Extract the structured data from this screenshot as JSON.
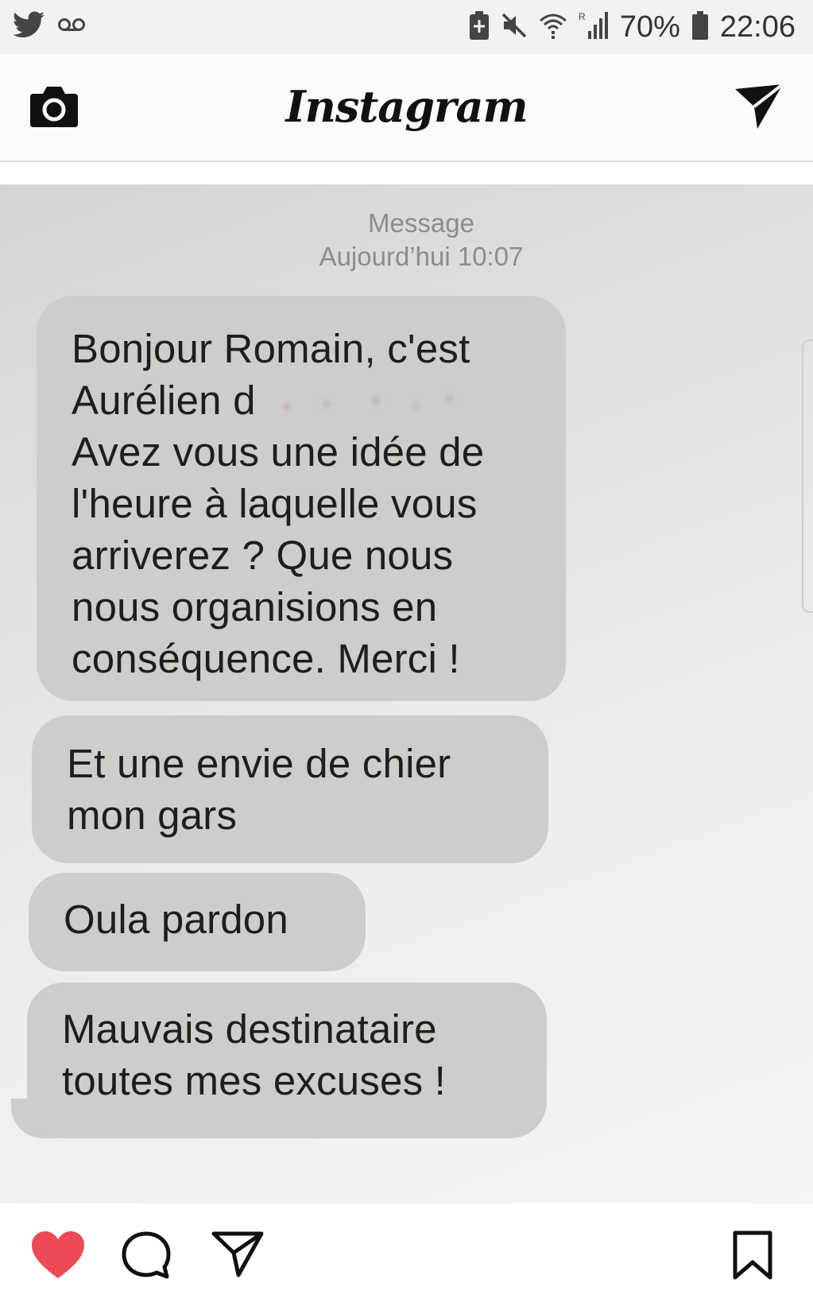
{
  "status_bar": {
    "battery_percent": "70%",
    "time": "22:06",
    "icons": [
      "twitter-icon",
      "voicemail-icon",
      "save-data-icon",
      "mute-icon",
      "wifi-icon",
      "signal-icon",
      "battery-icon"
    ]
  },
  "header": {
    "app_name": "Instagram",
    "icons": [
      "camera-icon",
      "direct-message-icon"
    ]
  },
  "post_image": {
    "meta_title": "Message",
    "meta_date": "Aujourd’hui 10:07",
    "bubbles": [
      {
        "lines": [
          "Bonjour Romain, c'est",
          "Aurélien d",
          "Avez vous une idée de",
          "l'heure à laquelle vous",
          "arriverez ? Que nous",
          "nous organisions en",
          "conséquence. Merci !"
        ]
      },
      {
        "lines": [
          "Et une envie de chier",
          "mon gars"
        ]
      },
      {
        "lines": [
          "Oula pardon"
        ]
      },
      {
        "lines": [
          "Mauvais destinataire",
          "toutes mes excuses !"
        ]
      }
    ]
  },
  "action_bar": {
    "liked": true,
    "like_color": "#ed4956",
    "icons": [
      "heart-icon",
      "comment-icon",
      "share-icon",
      "bookmark-icon"
    ]
  }
}
